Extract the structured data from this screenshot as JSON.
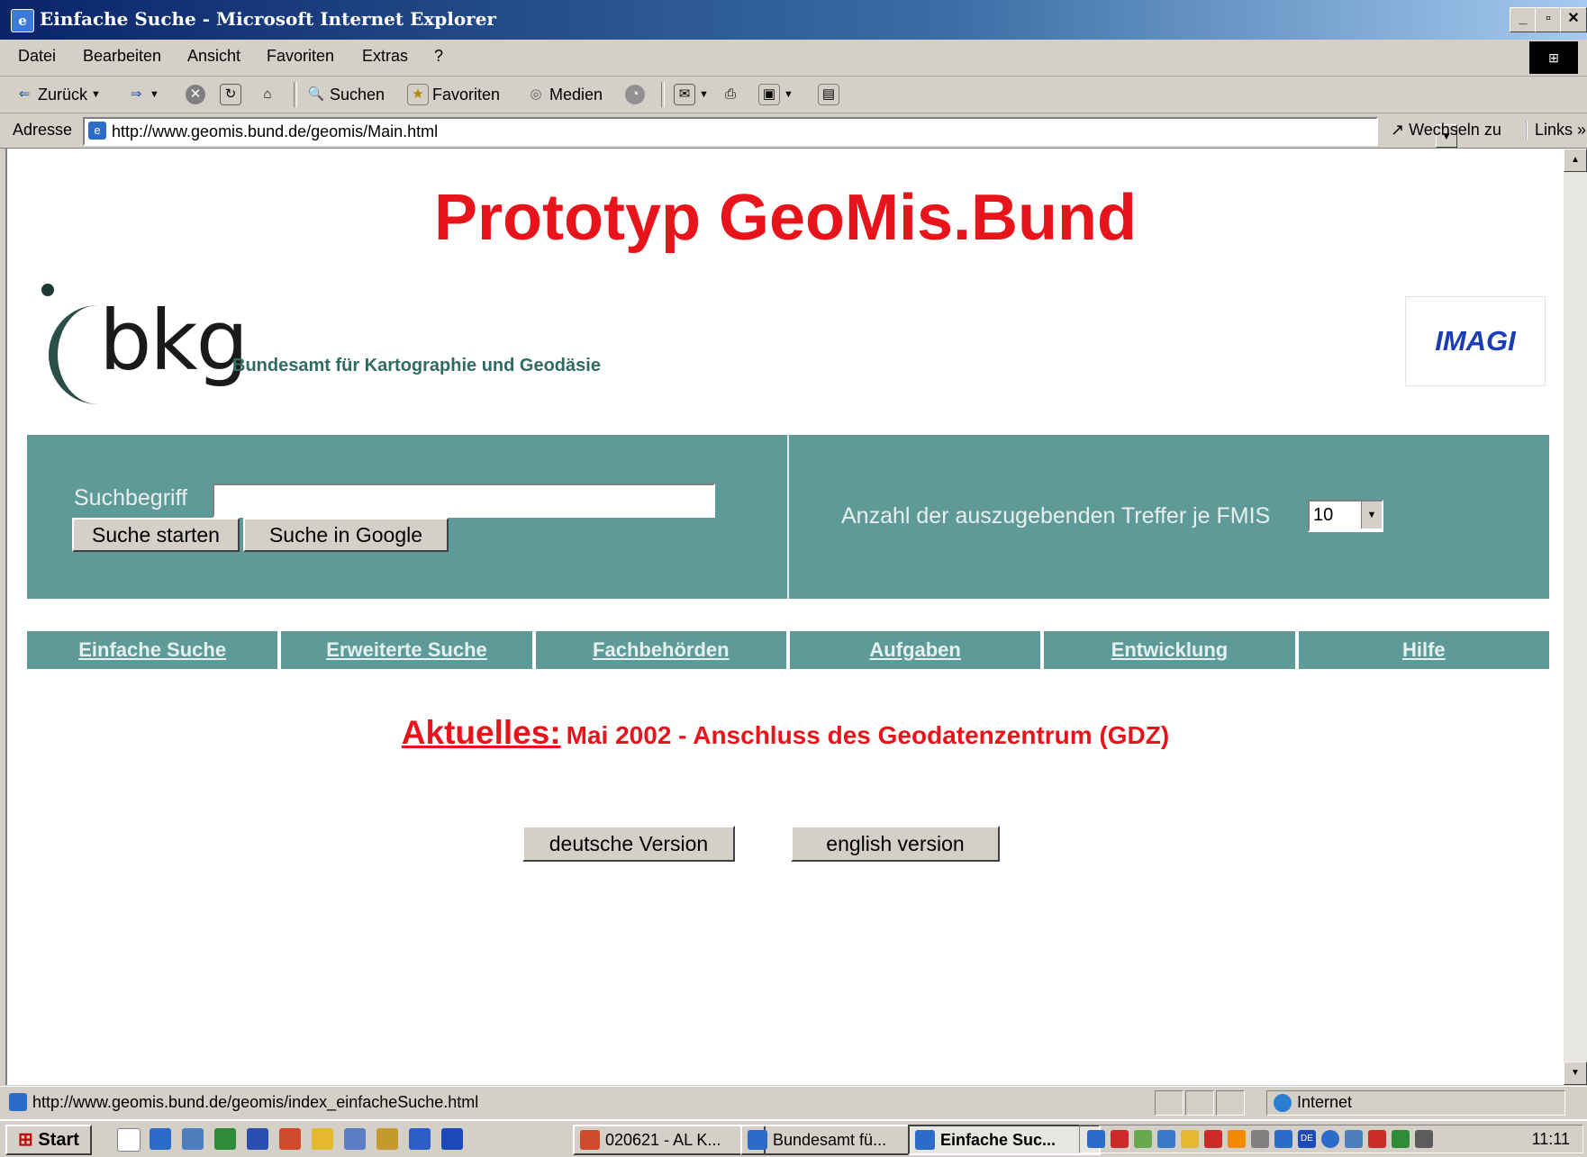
{
  "window": {
    "title": "Einfache Suche - Microsoft Internet Explorer",
    "app_icon": "ie-page-icon"
  },
  "menu": [
    "Datei",
    "Bearbeiten",
    "Ansicht",
    "Favoriten",
    "Extras",
    "?"
  ],
  "toolbar": {
    "back": "Zurück",
    "search": "Suchen",
    "favorites": "Favoriten",
    "media": "Medien"
  },
  "address": {
    "label": "Adresse",
    "url": "http://www.geomis.bund.de/geomis/Main.html",
    "go": "Wechseln zu",
    "links": "Links"
  },
  "page": {
    "title": "Prototyp GeoMis.Bund",
    "logo_word": "bkg",
    "logo_subtitle": "Bundesamt für Kartographie und Geodäsie",
    "partner_logo": "IMAGI",
    "search": {
      "label": "Suchbegriff",
      "value": "",
      "start_button": "Suche starten",
      "google_button": "Suche in Google",
      "count_label": "Anzahl der auszugebenden Treffer je FMIS",
      "count_value": "10"
    },
    "nav": [
      "Einfache Suche",
      "Erweiterte Suche",
      "Fachbehörden",
      "Aufgaben",
      "Entwicklung",
      "Hilfe"
    ],
    "news": {
      "label": "Aktuelles:",
      "text": "Mai 2002 - Anschluss des Geodatenzentrum (GDZ)"
    },
    "language": {
      "german": "deutsche Version",
      "english": "english version"
    }
  },
  "status": {
    "url": "http://www.geomis.bund.de/geomis/index_einfacheSuche.html",
    "zone": "Internet"
  },
  "taskbar": {
    "start": "Start",
    "tasks": [
      {
        "label": "020621 - AL K...",
        "active": false
      },
      {
        "label": "Bundesamt fü...",
        "active": false
      },
      {
        "label": "Einfache Suc...",
        "active": true
      }
    ],
    "clock": "11:11"
  },
  "colors": {
    "page_title": "#e8141c",
    "panel": "#5e9a98",
    "imagi": "#1a3cb4",
    "titlebar": "#0a246a"
  }
}
